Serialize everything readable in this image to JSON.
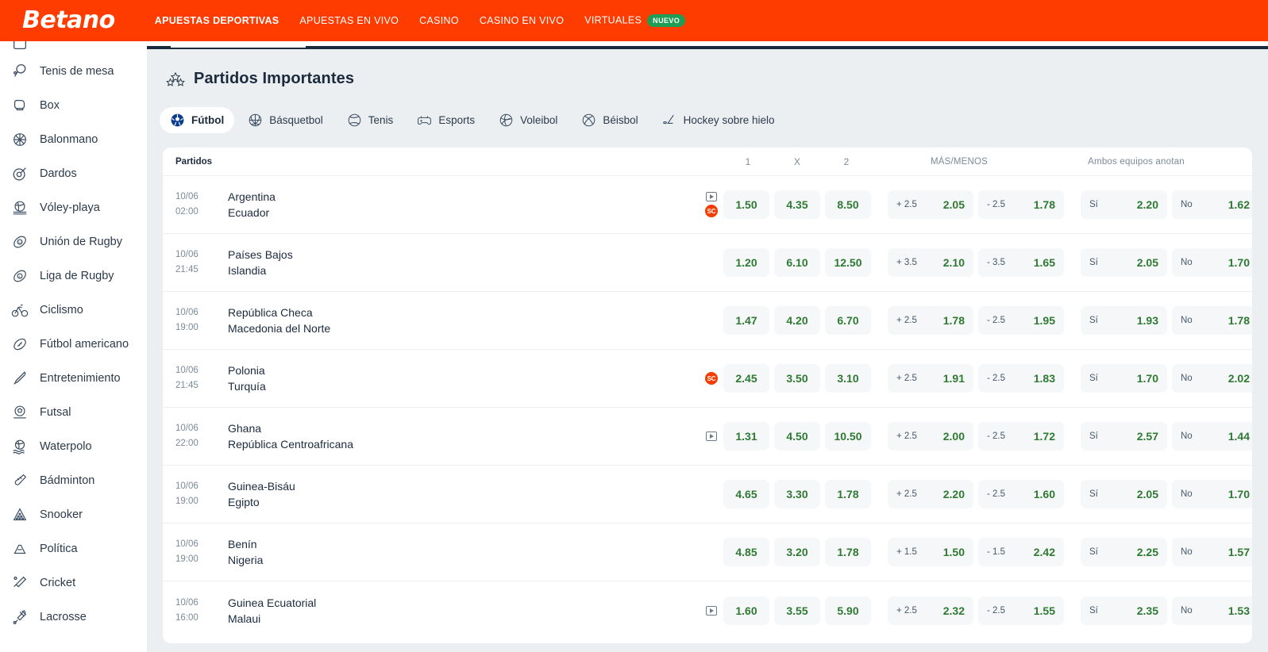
{
  "brand": {
    "logo_text": "Betano",
    "header_color": "#ff3c00"
  },
  "topnav": {
    "items": [
      {
        "label": "APUESTAS DEPORTIVAS",
        "active": true
      },
      {
        "label": "APUESTAS EN VIVO",
        "active": false
      },
      {
        "label": "CASINO",
        "active": false
      },
      {
        "label": "CASINO EN VIVO",
        "active": false
      },
      {
        "label": "VIRTUALES",
        "active": false,
        "badge": "NUEVO"
      }
    ],
    "badge_color": "#1f9d55"
  },
  "sidebar": {
    "items": [
      {
        "label": "",
        "icon": "partial-icon"
      },
      {
        "label": "Tenis de mesa",
        "icon": "table-tennis-icon"
      },
      {
        "label": "Box",
        "icon": "boxing-glove-icon"
      },
      {
        "label": "Balonmano",
        "icon": "handball-icon"
      },
      {
        "label": "Dardos",
        "icon": "darts-icon"
      },
      {
        "label": "Vóley-playa",
        "icon": "beach-volleyball-icon"
      },
      {
        "label": "Unión de Rugby",
        "icon": "rugby-union-icon"
      },
      {
        "label": "Liga de Rugby",
        "icon": "rugby-league-icon"
      },
      {
        "label": "Ciclismo",
        "icon": "cycling-icon"
      },
      {
        "label": "Fútbol americano",
        "icon": "american-football-icon"
      },
      {
        "label": "Entretenimiento",
        "icon": "microphone-icon"
      },
      {
        "label": "Futsal",
        "icon": "futsal-icon"
      },
      {
        "label": "Waterpolo",
        "icon": "waterpolo-icon"
      },
      {
        "label": "Bádminton",
        "icon": "badminton-icon"
      },
      {
        "label": "Snooker",
        "icon": "snooker-icon"
      },
      {
        "label": "Política",
        "icon": "politics-icon"
      },
      {
        "label": "Cricket",
        "icon": "cricket-icon"
      },
      {
        "label": "Lacrosse",
        "icon": "lacrosse-icon"
      }
    ]
  },
  "page": {
    "title": "Partidos Importantes",
    "title_icon": "three-stars-icon"
  },
  "sport_tabs": [
    {
      "label": "Fútbol",
      "icon": "soccer-ball-icon",
      "active": true
    },
    {
      "label": "Básquetbol",
      "icon": "basketball-icon",
      "active": false
    },
    {
      "label": "Tenis",
      "icon": "tennis-ball-icon",
      "active": false
    },
    {
      "label": "Esports",
      "icon": "gamepad-icon",
      "active": false
    },
    {
      "label": "Voleibol",
      "icon": "volleyball-icon",
      "active": false
    },
    {
      "label": "Béisbol",
      "icon": "baseball-icon",
      "active": false
    },
    {
      "label": "Hockey sobre hielo",
      "icon": "hockey-stick-icon",
      "active": false
    }
  ],
  "table": {
    "headers": {
      "matches": "Partidos",
      "home": "1",
      "draw": "X",
      "away": "2",
      "over_under": "MÁS/MENOS",
      "both_score": "Ambos equipos anotan"
    },
    "rows": [
      {
        "date": "10/06",
        "time": "02:00",
        "team_home": "Argentina",
        "team_away": "Ecuador",
        "has_stream": true,
        "has_sc": true,
        "o1": "1.50",
        "ox": "4.35",
        "o2": "8.50",
        "over_line": "+ 2.5",
        "over_odd": "2.05",
        "under_line": "- 2.5",
        "under_odd": "1.78",
        "yes_label": "Sí",
        "yes_odd": "2.20",
        "no_label": "No",
        "no_odd": "1.62"
      },
      {
        "date": "10/06",
        "time": "21:45",
        "team_home": "Países Bajos",
        "team_away": "Islandia",
        "has_stream": false,
        "has_sc": false,
        "o1": "1.20",
        "ox": "6.10",
        "o2": "12.50",
        "over_line": "+ 3.5",
        "over_odd": "2.10",
        "under_line": "- 3.5",
        "under_odd": "1.65",
        "yes_label": "Sí",
        "yes_odd": "2.05",
        "no_label": "No",
        "no_odd": "1.70"
      },
      {
        "date": "10/06",
        "time": "19:00",
        "team_home": "República Checa",
        "team_away": "Macedonia del Norte",
        "has_stream": false,
        "has_sc": false,
        "o1": "1.47",
        "ox": "4.20",
        "o2": "6.70",
        "over_line": "+ 2.5",
        "over_odd": "1.78",
        "under_line": "- 2.5",
        "under_odd": "1.95",
        "yes_label": "Sí",
        "yes_odd": "1.93",
        "no_label": "No",
        "no_odd": "1.78"
      },
      {
        "date": "10/06",
        "time": "21:45",
        "team_home": "Polonia",
        "team_away": "Turquía",
        "has_stream": false,
        "has_sc": true,
        "o1": "2.45",
        "ox": "3.50",
        "o2": "3.10",
        "over_line": "+ 2.5",
        "over_odd": "1.91",
        "under_line": "- 2.5",
        "under_odd": "1.83",
        "yes_label": "Sí",
        "yes_odd": "1.70",
        "no_label": "No",
        "no_odd": "2.02"
      },
      {
        "date": "10/06",
        "time": "22:00",
        "team_home": "Ghana",
        "team_away": "República Centroafricana",
        "has_stream": true,
        "has_sc": false,
        "o1": "1.31",
        "ox": "4.50",
        "o2": "10.50",
        "over_line": "+ 2.5",
        "over_odd": "2.00",
        "under_line": "- 2.5",
        "under_odd": "1.72",
        "yes_label": "Sí",
        "yes_odd": "2.57",
        "no_label": "No",
        "no_odd": "1.44"
      },
      {
        "date": "10/06",
        "time": "19:00",
        "team_home": "Guinea-Bisáu",
        "team_away": "Egipto",
        "has_stream": false,
        "has_sc": false,
        "o1": "4.65",
        "ox": "3.30",
        "o2": "1.78",
        "over_line": "+ 2.5",
        "over_odd": "2.20",
        "under_line": "- 2.5",
        "under_odd": "1.60",
        "yes_label": "Sí",
        "yes_odd": "2.05",
        "no_label": "No",
        "no_odd": "1.70"
      },
      {
        "date": "10/06",
        "time": "19:00",
        "team_home": "Benín",
        "team_away": "Nigeria",
        "has_stream": false,
        "has_sc": false,
        "o1": "4.85",
        "ox": "3.20",
        "o2": "1.78",
        "over_line": "+ 1.5",
        "over_odd": "1.50",
        "under_line": "- 1.5",
        "under_odd": "2.42",
        "yes_label": "Sí",
        "yes_odd": "2.25",
        "no_label": "No",
        "no_odd": "1.57"
      },
      {
        "date": "10/06",
        "time": "16:00",
        "team_home": "Guinea Ecuatorial",
        "team_away": "Malaui",
        "has_stream": true,
        "has_sc": false,
        "o1": "1.60",
        "ox": "3.55",
        "o2": "5.90",
        "over_line": "+ 2.5",
        "over_odd": "2.32",
        "under_line": "- 2.5",
        "under_odd": "1.55",
        "yes_label": "Sí",
        "yes_odd": "2.35",
        "no_label": "No",
        "no_odd": "1.53"
      }
    ]
  },
  "colors": {
    "odd_value": "#2f7a32",
    "sc_badge": "#f23c00",
    "accent_dark": "#1b2a3d"
  }
}
